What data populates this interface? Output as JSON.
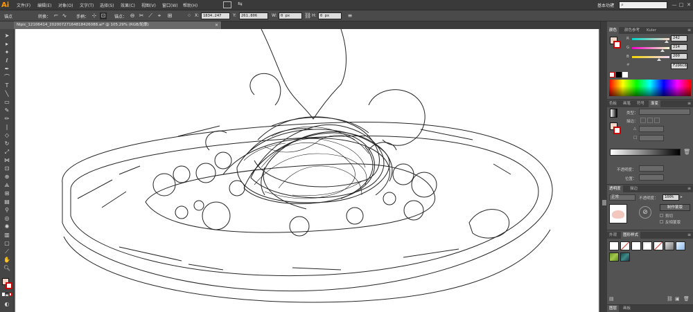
{
  "app": {
    "logo": "Ai"
  },
  "menu": {
    "items": [
      "文件(F)",
      "编辑(E)",
      "对象(O)",
      "文字(T)",
      "选择(S)",
      "效果(C)",
      "视图(V)",
      "窗口(W)",
      "帮助(H)"
    ]
  },
  "workspace": {
    "label": "基本功能",
    "caret": "▾"
  },
  "search": {
    "placeholder": ""
  },
  "window_controls": {
    "minimize": "—",
    "maximize": "□",
    "close": "✕"
  },
  "control_bar": {
    "selection_label": "锚点",
    "convert_label": "转换：",
    "handles_label": "手柄：",
    "anchor_label": "锚点：",
    "x_value": "1834.247",
    "y_value": "261.806",
    "w_value": "0 px",
    "h_value": "0 px"
  },
  "document": {
    "tab_title": "Nipic_12106414_20200727164818426088.ai* @ 105.29% (RGB/轮廓)",
    "close": "✕"
  },
  "color_panel": {
    "tabs": [
      "颜色",
      "颜色参考",
      "Kuler"
    ],
    "channels": [
      {
        "name": "R",
        "value": "242",
        "color": "#ff0000"
      },
      {
        "name": "G",
        "value": "214",
        "color": "#00ff00"
      },
      {
        "name": "B",
        "value": "200",
        "color": "#0000ff"
      }
    ],
    "hex": "F2D6C8"
  },
  "gradient_panel": {
    "tabs": [
      "色板",
      "画笔",
      "符号",
      "渐变"
    ],
    "type_label": "类型：",
    "stroke_label": "描边：",
    "angle_label": "△",
    "ratio_label": "□",
    "opacity_label": "不透明度：",
    "location_label": "位置："
  },
  "transparency_panel": {
    "tabs": [
      "透明度",
      "描边"
    ],
    "blend_mode": "正常",
    "opacity_label": "不透明度：",
    "opacity_value": "100%",
    "make_mask": "制作蒙版",
    "clip": "剪切",
    "invert_mask": "反相蒙版",
    "thumb_color": "#f2c7bd"
  },
  "graphic_styles_panel": {
    "tabs": [
      "外观",
      "图形样式"
    ]
  },
  "bottom_tabs": [
    "图层",
    "画板"
  ],
  "accent": "#ff9a00"
}
